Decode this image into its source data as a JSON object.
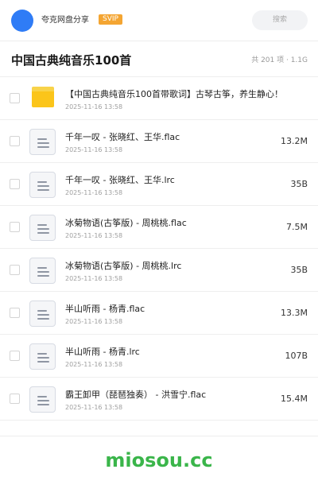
{
  "header": {
    "owner_name": "夸克网盘分享",
    "badge": "SVIP",
    "search_placeholder": "搜索",
    "avatar_color": "#2f7cf6",
    "badge_color": "#f4a532"
  },
  "share": {
    "title": "中国古典纯音乐100首",
    "meta": "共 201 项 · 1.1G"
  },
  "items": [
    {
      "type": "folder",
      "icon": "folder-icon",
      "name": "【中国古典纯音乐100首带歌词】古琴古筝，养生静心！",
      "date": "2025-11-16 13:58",
      "size": ""
    },
    {
      "type": "file",
      "icon": "file-icon",
      "name": "千年一叹 - 张晓红、王华.flac",
      "date": "2025-11-16 13:58",
      "size": "13.2M"
    },
    {
      "type": "file",
      "icon": "file-icon",
      "name": "千年一叹 - 张晓红、王华.lrc",
      "date": "2025-11-16 13:58",
      "size": "35B"
    },
    {
      "type": "file",
      "icon": "file-icon",
      "name": "冰菊物语(古筝版) - 周桃桃.flac",
      "date": "2025-11-16 13:58",
      "size": "7.5M"
    },
    {
      "type": "file",
      "icon": "file-icon",
      "name": "冰菊物语(古筝版) - 周桃桃.lrc",
      "date": "2025-11-16 13:58",
      "size": "35B"
    },
    {
      "type": "file",
      "icon": "file-icon",
      "name": "半山听雨 - 杨青.flac",
      "date": "2025-11-16 13:58",
      "size": "13.3M"
    },
    {
      "type": "file",
      "icon": "file-icon",
      "name": "半山听雨 - 杨青.lrc",
      "date": "2025-11-16 13:58",
      "size": "107B"
    },
    {
      "type": "file",
      "icon": "file-icon",
      "name": "霸王卸甲（琵琶独奏） - 洪雪宁.flac",
      "date": "2025-11-16 13:58",
      "size": "15.4M"
    }
  ],
  "footer": {
    "watermark": "miosou.cc",
    "watermark_color": "#3ab54a"
  }
}
